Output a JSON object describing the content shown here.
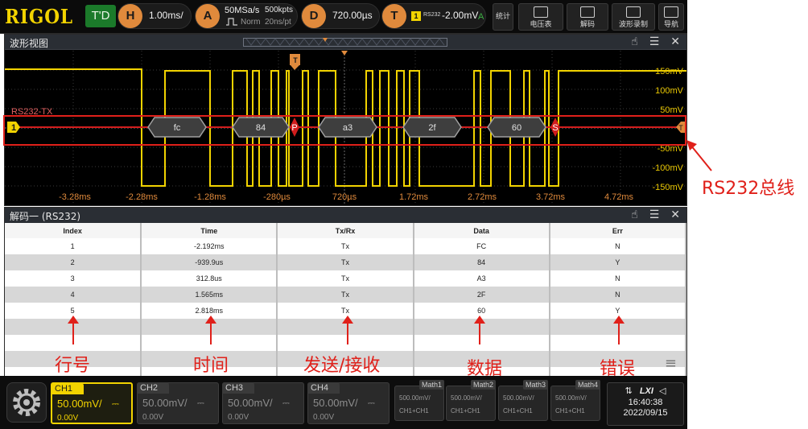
{
  "topbar": {
    "logo": "RIGOL",
    "trigger_status": "T'D",
    "horizontal": {
      "badge": "H",
      "timebase": "1.00ms/"
    },
    "acquire": {
      "badge": "A",
      "sample_rate": "50MSa/s",
      "mode": "Norm",
      "memory_depth": "500kpts",
      "sample_interval": "20ns/pt"
    },
    "delay": {
      "badge": "D",
      "value": "720.00µs"
    },
    "trigger": {
      "badge": "T",
      "source": "1",
      "type": "RS232",
      "level": "-2.00mV",
      "coupling": "A"
    },
    "buttons": [
      {
        "label": "统计"
      },
      {
        "label": "电压表"
      },
      {
        "label": "解码"
      },
      {
        "label": "波形录制"
      },
      {
        "label": "导航"
      }
    ]
  },
  "wave_window": {
    "title": "波形视图",
    "bus_label": "RS232-TX",
    "channel_marker": "1",
    "trigger_marker": "T",
    "decode_frames": [
      "fc",
      "84",
      "a3",
      "2f",
      "60"
    ],
    "parity_marker": "P",
    "stop_marker": "S",
    "end_marker": "T",
    "volt_labels": [
      "150mV",
      "100mV",
      "50mV",
      "-50mV",
      "-100mV",
      "-150mV"
    ],
    "time_labels": [
      "-3.28ms",
      "-2.28ms",
      "-1.28ms",
      "-280µs",
      "720µs",
      "1.72ms",
      "2.72ms",
      "3.72ms",
      "4.72ms"
    ]
  },
  "decode_window": {
    "title": "解码一 (RS232)",
    "columns": [
      "Index",
      "Time",
      "Tx/Rx",
      "Data",
      "Err"
    ],
    "rows": [
      [
        "1",
        "-2.192ms",
        "Tx",
        "FC",
        "N"
      ],
      [
        "2",
        "-939.9us",
        "Tx",
        "84",
        "Y"
      ],
      [
        "3",
        "312.8us",
        "Tx",
        "A3",
        "N"
      ],
      [
        "4",
        "1.565ms",
        "Tx",
        "2F",
        "N"
      ],
      [
        "5",
        "2.818ms",
        "Tx",
        "60",
        "Y"
      ]
    ]
  },
  "annotations": {
    "bus": "RS232总线",
    "row": "行号",
    "time": "时间",
    "txrx": "发送/接收",
    "data": "数据",
    "err": "错误"
  },
  "bottombar": {
    "channels": [
      {
        "name": "CH1",
        "scale": "50.00mV/",
        "offset": "0.00V",
        "active": true
      },
      {
        "name": "CH2",
        "scale": "50.00mV/",
        "offset": "0.00V"
      },
      {
        "name": "CH3",
        "scale": "50.00mV/",
        "offset": "0.00V"
      },
      {
        "name": "CH4",
        "scale": "50.00mV/",
        "offset": "0.00V"
      }
    ],
    "math": [
      {
        "name": "Math1",
        "scale": "500.00mV/",
        "source": "CH1+CH1"
      },
      {
        "name": "Math2",
        "scale": "500.00mV/",
        "source": "CH1+CH1"
      },
      {
        "name": "Math3",
        "scale": "500.00mV/",
        "source": "CH1+CH1"
      },
      {
        "name": "Math4",
        "scale": "500.00mV/",
        "source": "CH1+CH1"
      }
    ],
    "status": {
      "lxi": "LXI",
      "time": "16:40:38",
      "date": "2022/09/15"
    }
  },
  "colors": {
    "ch1": "#f2d300",
    "decode_bus": "#d21d1d",
    "annotation": "#e0201a",
    "trigger": "#e08a3c"
  }
}
